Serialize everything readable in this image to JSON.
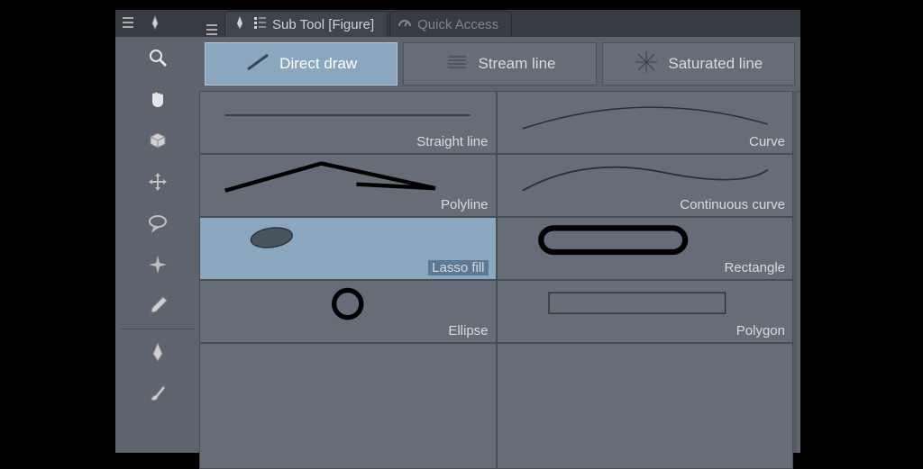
{
  "tabs": {
    "subtool": {
      "label": "Sub Tool [Figure]"
    },
    "quick_access": {
      "label": "Quick Access"
    }
  },
  "categories": {
    "direct_draw": {
      "label": "Direct draw",
      "active": true
    },
    "stream_line": {
      "label": "Stream line",
      "active": false
    },
    "saturated_line": {
      "label": "Saturated line",
      "active": false
    }
  },
  "subtools": {
    "straight_line": {
      "label": "Straight line"
    },
    "curve": {
      "label": "Curve"
    },
    "polyline": {
      "label": "Polyline"
    },
    "continuous_curve": {
      "label": "Continuous curve"
    },
    "lasso_fill": {
      "label": "Lasso fill",
      "active": true
    },
    "rectangle": {
      "label": "Rectangle"
    },
    "ellipse": {
      "label": "Ellipse"
    },
    "polygon": {
      "label": "Polygon"
    }
  },
  "toolbar": {
    "items": [
      "magnifier",
      "hand",
      "shape-3d",
      "move-arrows",
      "balloon",
      "star-sparkle",
      "eyedropper",
      "pen-nib",
      "brush"
    ]
  },
  "colors": {
    "accent": "#8aa7bf",
    "panel": "#5d646e",
    "panel_light": "#666d77",
    "border": "#474d55"
  }
}
